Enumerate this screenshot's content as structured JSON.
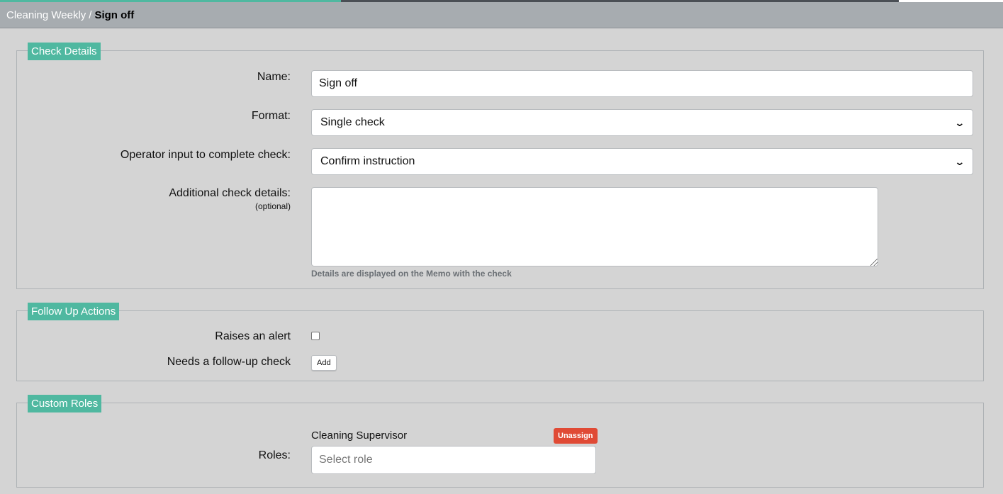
{
  "breadcrumb": {
    "parent": "Cleaning Weekly",
    "separator": "/",
    "current": "Sign off"
  },
  "progress": {
    "accent_fraction": 0.34,
    "completed_fraction": 0.896
  },
  "check_details": {
    "legend": "Check Details",
    "name_label": "Name:",
    "name_value": "Sign off",
    "format_label": "Format:",
    "format_value": "Single check",
    "operator_label": "Operator input to complete check:",
    "operator_value": "Confirm instruction",
    "additional_label": "Additional check details:",
    "additional_sublabel": "(optional)",
    "additional_value": "",
    "additional_hint": "Details are displayed on the Memo with the check"
  },
  "follow_up": {
    "legend": "Follow Up Actions",
    "alert_label": "Raises an alert",
    "alert_checked": false,
    "followup_label": "Needs a follow-up check",
    "add_button": "Add"
  },
  "custom_roles": {
    "legend": "Custom Roles",
    "assigned_role": "Cleaning Supervisor",
    "unassign_button": "Unassign",
    "roles_label": "Roles:",
    "role_placeholder": "Select role"
  },
  "colors": {
    "accent": "#4fb8a0",
    "danger": "#e04a35",
    "topbar": "#a7acb0",
    "background": "#d4d4d4"
  }
}
